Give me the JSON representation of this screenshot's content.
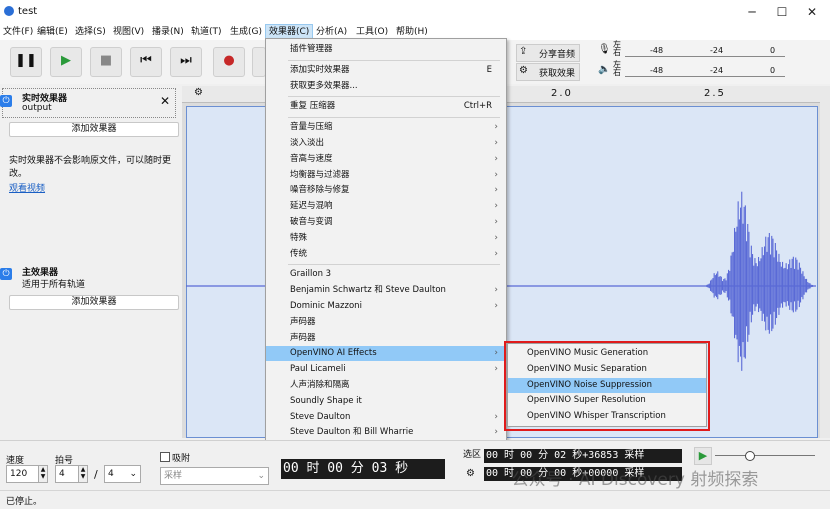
{
  "window": {
    "title": "test",
    "minimize": "─",
    "maximize": "☐",
    "close": "✕"
  },
  "menubar": [
    "文件(F)",
    "编辑(E)",
    "选择(S)",
    "视图(V)",
    "播录(N)",
    "轨道(T)",
    "生成(G)",
    "效果器(C)",
    "分析(A)",
    "工具(O)",
    "帮助(H)"
  ],
  "toolbar": {
    "share_audio": "分享音频",
    "get_effects": "获取效果",
    "meter_ticks": [
      "-48",
      "-24",
      "0"
    ],
    "meter_lr": [
      "左",
      "右"
    ],
    "ruler": [
      "2.0",
      "2.5"
    ]
  },
  "left_panel": {
    "realtime_title": "实时效果器",
    "realtime_sub": "output",
    "add_effect": "添加效果器",
    "info": "实时效果器不会影响原文件，可以随时更改。",
    "watch_video": "观看视频",
    "master_title": "主效果器",
    "master_sub": "适用于所有轨道",
    "master_add_effect": "添加效果器"
  },
  "effect_menu": {
    "items": [
      {
        "label": "插件管理器"
      },
      {
        "sep": true
      },
      {
        "label": "添加实时效果器",
        "shortcut": "E"
      },
      {
        "label": "获取更多效果器..."
      },
      {
        "sep": true
      },
      {
        "label": "重复 压缩器",
        "shortcut": "Ctrl+R"
      },
      {
        "sep": true
      },
      {
        "label": "音量与压缩",
        "arrow": true
      },
      {
        "label": "淡入淡出",
        "arrow": true
      },
      {
        "label": "音高与速度",
        "arrow": true
      },
      {
        "label": "均衡器与过滤器",
        "arrow": true
      },
      {
        "label": "噪音移除与修复",
        "arrow": true
      },
      {
        "label": "延迟与混响",
        "arrow": true
      },
      {
        "label": "破音与变调",
        "arrow": true
      },
      {
        "label": "特殊",
        "arrow": true
      },
      {
        "label": "传统",
        "arrow": true
      },
      {
        "sep": true
      },
      {
        "label": "Graillon 3"
      },
      {
        "label": "Benjamin Schwartz 和 Steve Daulton",
        "arrow": true
      },
      {
        "label": "Dominic Mazzoni",
        "arrow": true
      },
      {
        "label": "声码器"
      },
      {
        "label": "声码器"
      },
      {
        "label": "OpenVINO AI Effects",
        "arrow": true,
        "highlight": true
      },
      {
        "label": "Paul Licameli",
        "arrow": true
      },
      {
        "label": "人声消除和隔离"
      },
      {
        "label": "Soundly Shape it"
      },
      {
        "label": "Steve Daulton",
        "arrow": true
      },
      {
        "label": "Steve Daulton 和 Bill Wharrie",
        "arrow": true
      }
    ]
  },
  "submenu": {
    "items": [
      {
        "label": "OpenVINO Music Generation"
      },
      {
        "label": "OpenVINO Music Separation"
      },
      {
        "label": "OpenVINO Noise Suppression",
        "highlight": true
      },
      {
        "label": "OpenVINO Super Resolution"
      },
      {
        "label": "OpenVINO Whisper Transcription"
      }
    ]
  },
  "bottom": {
    "speed_label": "速度",
    "beat_label": "拍号",
    "speed_value": "120",
    "beat_num": "4",
    "beat_slash": "/",
    "beat_den": "4",
    "snap_label": "吸附",
    "snap_value": "采样",
    "time_main": "00 时 00 分 03 秒",
    "selection_label": "选区",
    "sel_start": "00 时 00 分 02 秒+36853 采样",
    "sel_end": "00 时 00 分 00 秒+00000 采样"
  },
  "watermark": "公众号 · AI Discovery 射频探索",
  "status": "已停止。",
  "colors": {
    "accent": "#2b7de9",
    "highlight": "#91c9f7",
    "waveform": "#5a6ad6",
    "outline": "#e01b1b"
  }
}
